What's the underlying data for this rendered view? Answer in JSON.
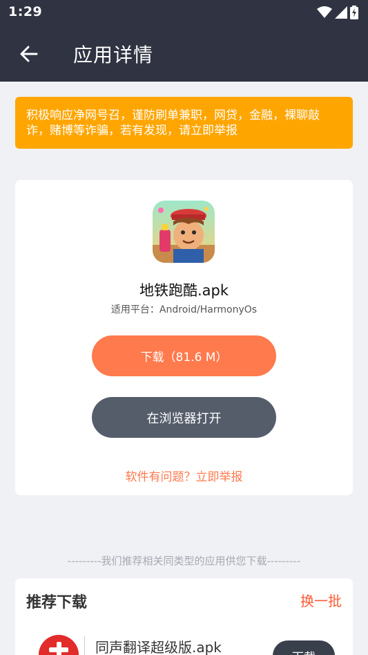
{
  "status_bar": {
    "time": "1:29",
    "icons": [
      "wifi-icon",
      "signal-icon",
      "battery-charging-icon"
    ]
  },
  "app_bar": {
    "title": "应用详情",
    "back_icon": "arrow-left-icon"
  },
  "warning": {
    "text": "积极响应净网号召，谨防刷单兼职，网贷，金融，裸聊敲诈，赌博等诈骗，若有发现，请立即举报",
    "color": "#ffa500"
  },
  "app_detail": {
    "name": "地铁跑酷.apk",
    "platform": "适用平台：Android/HarmonyOs",
    "download_label": "下载（81.6 M）",
    "browser_label": "在浏览器打开",
    "report_label": "软件有问题？立即举报"
  },
  "recommend": {
    "divider_text": "---------我们推荐相关同类型的应用供您下载---------",
    "title": "推荐下载",
    "refresh_label": "换一批",
    "items": [
      {
        "name": "同声翻译超级版.apk",
        "button_label": "下载"
      }
    ]
  },
  "colors": {
    "header": "#2f3342",
    "accent": "#ff7a4d",
    "secondary_button": "#555d6b",
    "background": "#f0f1f5"
  }
}
